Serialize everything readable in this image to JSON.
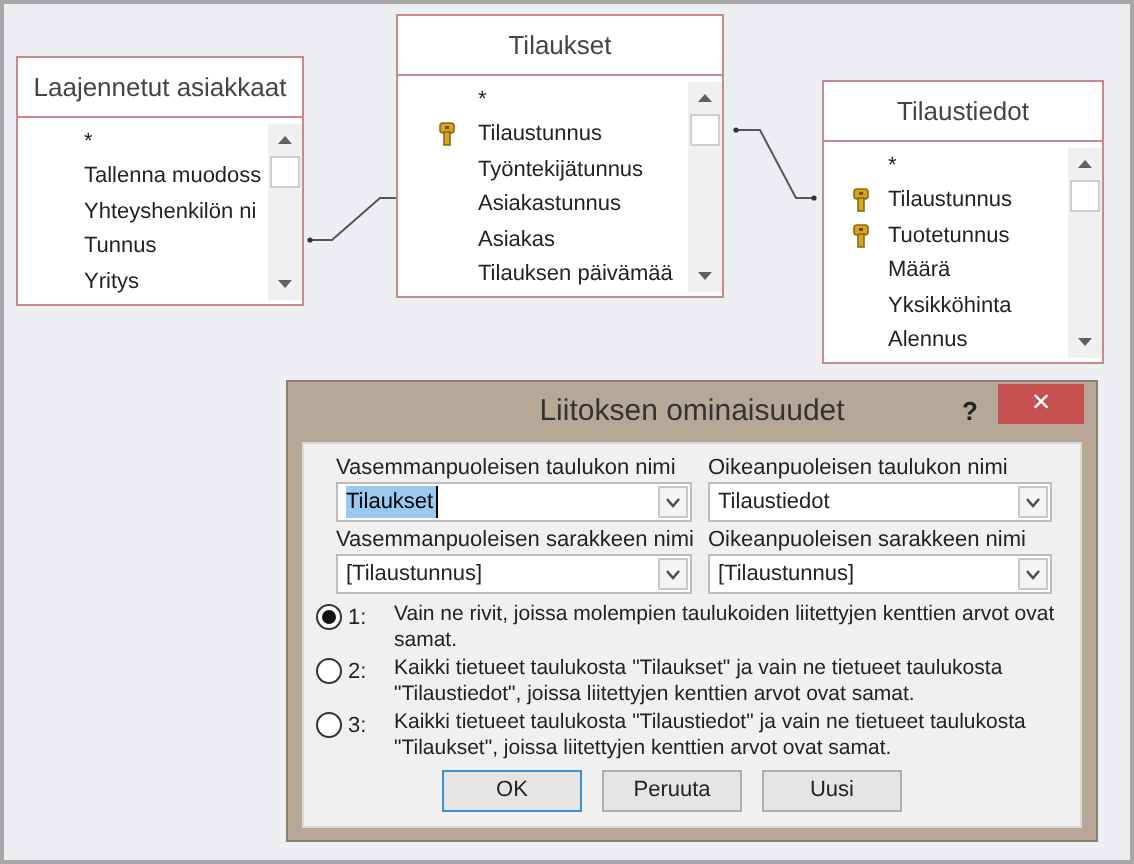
{
  "tables": [
    {
      "title": "Laajennetut asiakkaat",
      "fields": [
        {
          "name": "*",
          "key": false
        },
        {
          "name": "Tallenna muodoss",
          "key": false
        },
        {
          "name": "Yhteyshenkilön ni",
          "key": false
        },
        {
          "name": "Tunnus",
          "key": false
        },
        {
          "name": "Yritys",
          "key": false
        }
      ]
    },
    {
      "title": "Tilaukset",
      "fields": [
        {
          "name": "*",
          "key": false
        },
        {
          "name": "Tilaustunnus",
          "key": true
        },
        {
          "name": "Työntekijätunnus",
          "key": false
        },
        {
          "name": "Asiakastunnus",
          "key": false
        },
        {
          "name": "Asiakas",
          "key": false
        },
        {
          "name": "Tilauksen päivämää",
          "key": false
        }
      ]
    },
    {
      "title": "Tilaustiedot",
      "fields": [
        {
          "name": "*",
          "key": false
        },
        {
          "name": "Tilaustunnus",
          "key": true
        },
        {
          "name": "Tuotetunnus",
          "key": true
        },
        {
          "name": "Määrä",
          "key": false
        },
        {
          "name": "Yksikköhinta",
          "key": false
        },
        {
          "name": "Alennus",
          "key": false
        }
      ]
    }
  ],
  "dialog": {
    "title": "Liitoksen ominaisuudet",
    "help": "?",
    "close": "×",
    "fields": [
      {
        "label": "Vasemmanpuoleisen taulukon nimi",
        "value": "Tilaukset",
        "focused": true
      },
      {
        "label": "Oikeanpuoleisen taulukon nimi",
        "value": "Tilaustiedot",
        "focused": false
      },
      {
        "label": "Vasemmanpuoleisen sarakkeen nimi",
        "value": "[Tilaustunnus]",
        "focused": false
      },
      {
        "label": "Oikeanpuoleisen sarakkeen nimi",
        "value": "[Tilaustunnus]",
        "focused": false
      }
    ],
    "options": [
      {
        "number": "1:",
        "text": "Vain ne rivit, joissa molempien taulukoiden liitettyjen kenttien arvot ovat samat.",
        "selected": true
      },
      {
        "number": "2:",
        "text": "Kaikki tietueet taulukosta \"Tilaukset\" ja vain ne tietueet taulukosta \"Tilaustiedot\", joissa liitettyjen kenttien arvot ovat samat.",
        "selected": false
      },
      {
        "number": "3:",
        "text": "Kaikki tietueet taulukosta \"Tilaustiedot\" ja vain ne tietueet taulukosta \"Tilaukset\", joissa liitettyjen kenttien arvot ovat samat.",
        "selected": false
      }
    ],
    "buttons": [
      {
        "label": "OK",
        "default": true
      },
      {
        "label": "Peruuta",
        "default": false
      },
      {
        "label": "Uusi",
        "default": false
      }
    ]
  }
}
